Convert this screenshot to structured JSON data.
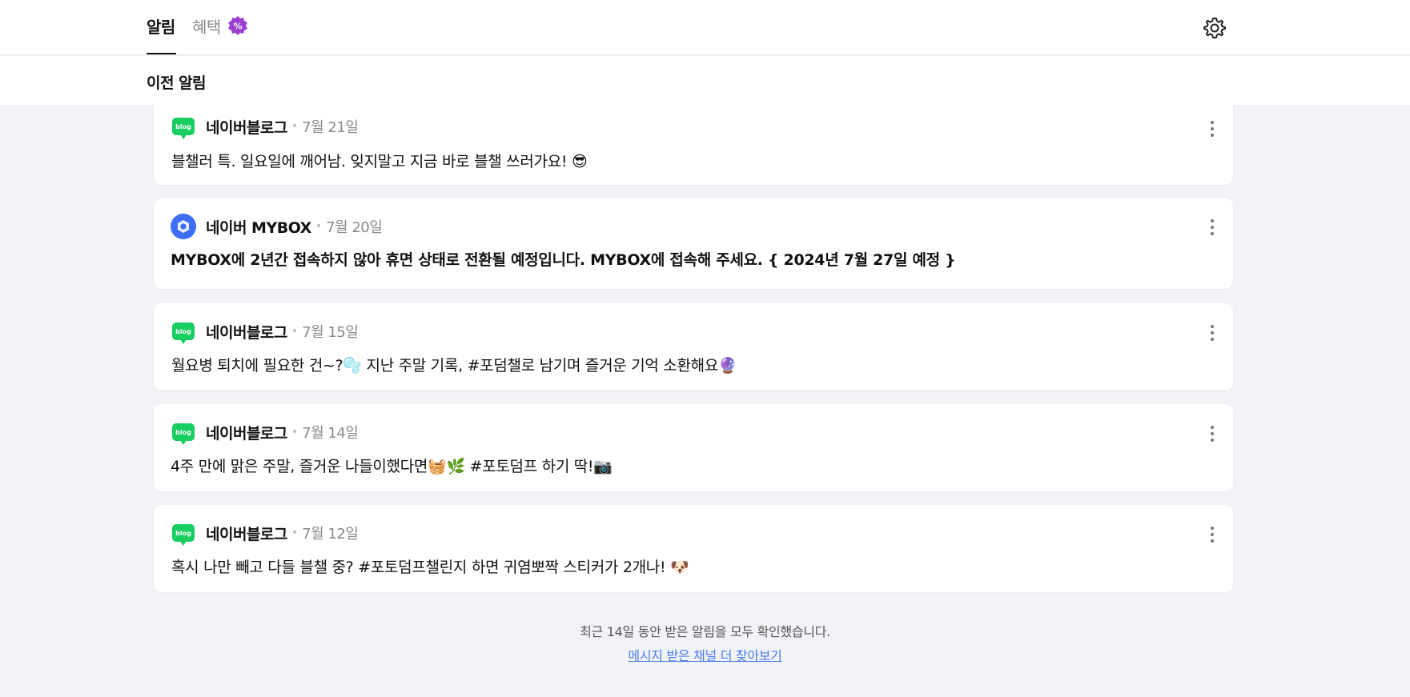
{
  "header": {
    "tabs": [
      {
        "label": "알림",
        "active": true
      },
      {
        "label": "혜택",
        "active": false
      }
    ],
    "settings_icon": "gear-icon",
    "badge_icon": "percent-badge-icon"
  },
  "subheader": {
    "title": "이전 알림"
  },
  "notifications": [
    {
      "channel": "네이버블로그",
      "icon": "blog-icon",
      "date": "7월 21일",
      "message": "블챌러 특. 일요일에 깨어남. 잊지말고 지금 바로 블챌 쓰러가요! 😎",
      "bold": false
    },
    {
      "channel": "네이버 MYBOX",
      "icon": "mybox-icon",
      "date": "7월 20일",
      "message": "MYBOX에 2년간 접속하지 않아 휴면 상태로 전환될 예정입니다. MYBOX에 접속해 주세요. { 2024년 7월 27일 예정 }",
      "bold": true
    },
    {
      "channel": "네이버블로그",
      "icon": "blog-icon",
      "date": "7월 15일",
      "message": "월요병 퇴치에 필요한 건~?🫧 지난 주말 기록, #포덤챌로 남기며 즐거운 기억 소환해요🔮",
      "bold": false
    },
    {
      "channel": "네이버블로그",
      "icon": "blog-icon",
      "date": "7월 14일",
      "message": "4주 만에 맑은 주말, 즐거운 나들이했다면🧺🌿 #포토덤프 하기 딱!📷",
      "bold": false
    },
    {
      "channel": "네이버블로그",
      "icon": "blog-icon",
      "date": "7월 12일",
      "message": "혹시 나만 빼고 다들 블챌 중? #포토덤프챌린지 하면 귀염뽀짝 스티커가 2개나! 🐶",
      "bold": false
    }
  ],
  "footer": {
    "text": "최근 14일 동안 받은 알림을 모두 확인했습니다.",
    "link": "메시지 받은 채널 더 찾아보기"
  },
  "colors": {
    "background": "#f2f3f6",
    "blog_green": "#19ce60",
    "mybox_blue": "#3e6ef5",
    "link_blue": "#4b7bec",
    "badge_purple": "#9b3fd0"
  }
}
